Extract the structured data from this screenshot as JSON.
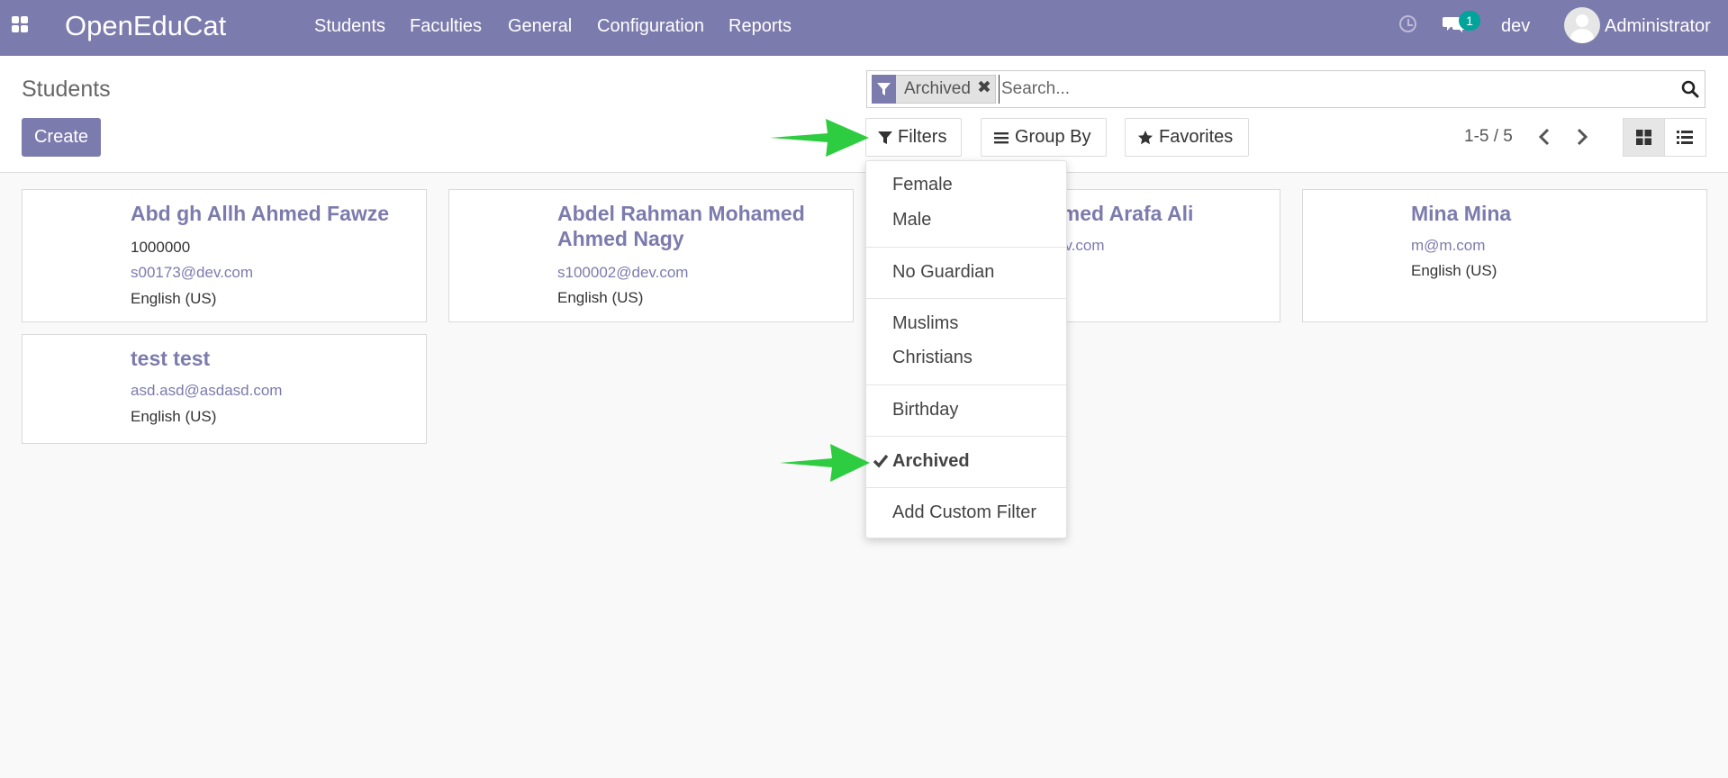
{
  "navbar": {
    "brand": "OpenEduCat",
    "menu": [
      "Students",
      "Faculties",
      "General",
      "Configuration",
      "Reports"
    ],
    "notification_count": "1",
    "database": "dev",
    "user": "Administrator"
  },
  "control_panel": {
    "title": "Students",
    "create_label": "Create",
    "search": {
      "facet_value": "Archived",
      "placeholder": "Search..."
    },
    "filters_label": "Filters",
    "group_by_label": "Group By",
    "favorites_label": "Favorites",
    "pager": "1-5 / 5"
  },
  "students": [
    {
      "name": "Abd gh Allh Ahmed Fawze",
      "lines": [
        "1000000",
        "s00173@dev.com",
        "English (US)"
      ]
    },
    {
      "name": "Abdel Rahman Mohamed Ahmed Nagy",
      "lines": [
        "s100002@dev.com",
        "English (US)"
      ]
    },
    {
      "name": "amed Arafa Ali",
      "lines": [
        "ev.com",
        ")"
      ]
    },
    {
      "name": "Mina Mina",
      "lines": [
        "m@m.com",
        "English (US)"
      ]
    },
    {
      "name": "test test",
      "lines": [
        "asd.asd@asdasd.com",
        "English (US)"
      ]
    }
  ],
  "filter_menu": {
    "items": [
      "Female",
      "Male",
      "No Guardian",
      "Muslims",
      "Christians",
      "Birthday",
      "Archived",
      "Add Custom Filter"
    ],
    "selected": "Archived"
  },
  "colors": {
    "brand": "#7c7bad",
    "badge": "#01a39a",
    "annotation_arrow": "#2ecc40"
  }
}
